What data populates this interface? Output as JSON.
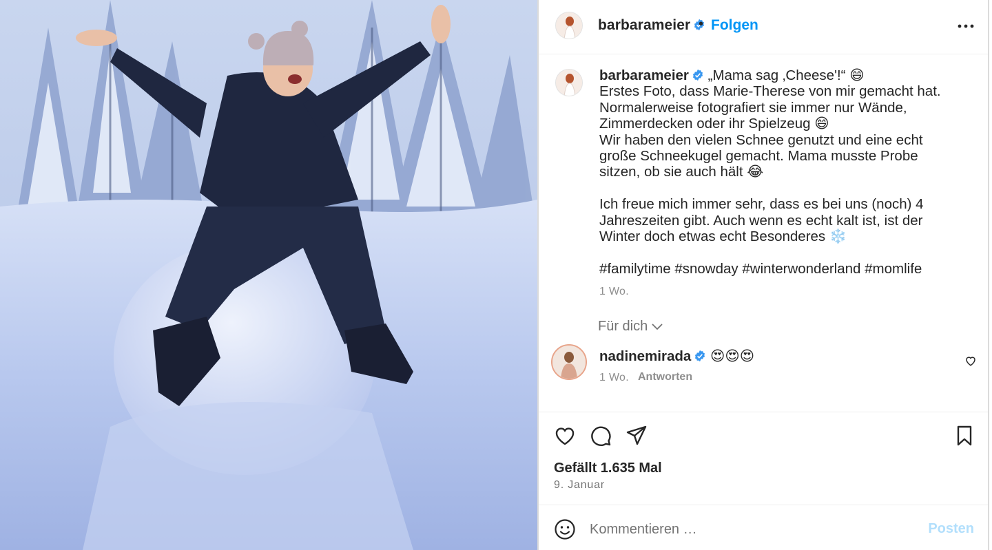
{
  "photo": {
    "subject": "woman sitting on a snowball in a snowy forest"
  },
  "header": {
    "username": "barbarameier",
    "verified_icon": "verified-badge-icon",
    "separator": "•",
    "follow_label": "Folgen",
    "more_icon": "more-options-icon"
  },
  "caption": {
    "username": "barbarameier",
    "text_line1": "„Mama sag ‚Cheese'!“ 😄",
    "text_body": "Erstes Foto, dass Marie-Therese von mir gemacht hat.\nNormalerweise fotografiert sie immer nur Wände, Zimmerdecken oder ihr Spielzeug 😄\nWir haben den vielen Schnee genutzt und eine echt große Schneekugel gemacht. Mama musste Probe sitzen, ob sie auch hält 😂\n\nIch freue mich immer sehr, dass es bei uns (noch) 4 Jahreszeiten gibt. Auch wenn es echt kalt ist, ist der Winter doch etwas echt Besonderes ❄️\n\n#familytime #snowday #winterwonderland #momlife",
    "time": "1 Wo."
  },
  "comments_filter": {
    "label": "Für dich",
    "chevron_icon": "chevron-down-icon"
  },
  "comments": [
    {
      "username": "nadinemirada",
      "text": "😍😍😍",
      "time": "1 Wo.",
      "reply_label": "Antworten",
      "like_icon": "heart-icon"
    }
  ],
  "actions": {
    "like_icon": "heart-icon",
    "comment_icon": "comment-icon",
    "share_icon": "share-icon",
    "save_icon": "bookmark-icon",
    "likes_text": "Gefällt 1.635 Mal",
    "date": "9. Januar"
  },
  "composer": {
    "emoji_icon": "emoji-icon",
    "placeholder": "Kommentieren …",
    "post_label": "Posten"
  },
  "colors": {
    "accent": "#0095f6",
    "verified": "#3897f0",
    "muted": "#737373",
    "post_disabled": "#b2dffc"
  }
}
